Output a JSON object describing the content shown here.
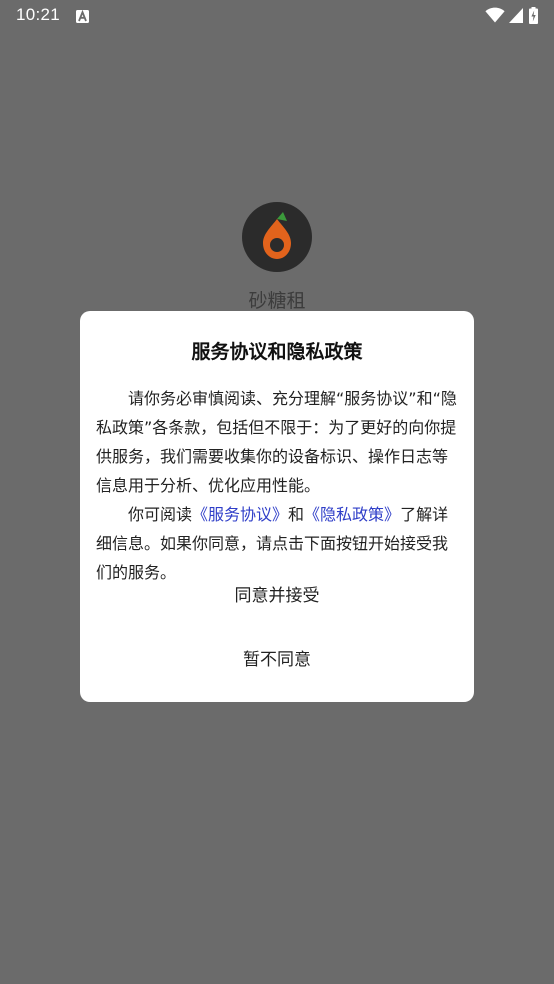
{
  "status_bar": {
    "time": "10:21",
    "notification_icon": "a-letter-icon",
    "icons": [
      "wifi-icon",
      "signal-icon",
      "battery-charging-icon"
    ]
  },
  "app": {
    "name": "砂糖租",
    "logo_icon": "app-logo-icon"
  },
  "dialog": {
    "title": "服务协议和隐私政策",
    "paragraph1": "请你务必审慎阅读、充分理解“服务协议”和“隐私政策”各条款，包括但不限于：为了更好的向你提供服务，我们需要收集你的设备标识、操作日志等信息用于分析、优化应用性能。",
    "paragraph2_prefix": "你可阅读",
    "service_link": "《服务协议》",
    "paragraph2_and": "和",
    "privacy_link": "《隐私政策》",
    "paragraph2_suffix": "了解详细信息。如果你同意，请点击下面按钮开始接受我们的服务。",
    "accept_label": "同意并接受",
    "decline_label": "暂不同意"
  },
  "colors": {
    "background": "#6b6b6b",
    "dialog_bg": "#ffffff",
    "link": "#2f3ec8",
    "logo_orange": "#e2631c",
    "logo_green": "#3b9a3b"
  }
}
